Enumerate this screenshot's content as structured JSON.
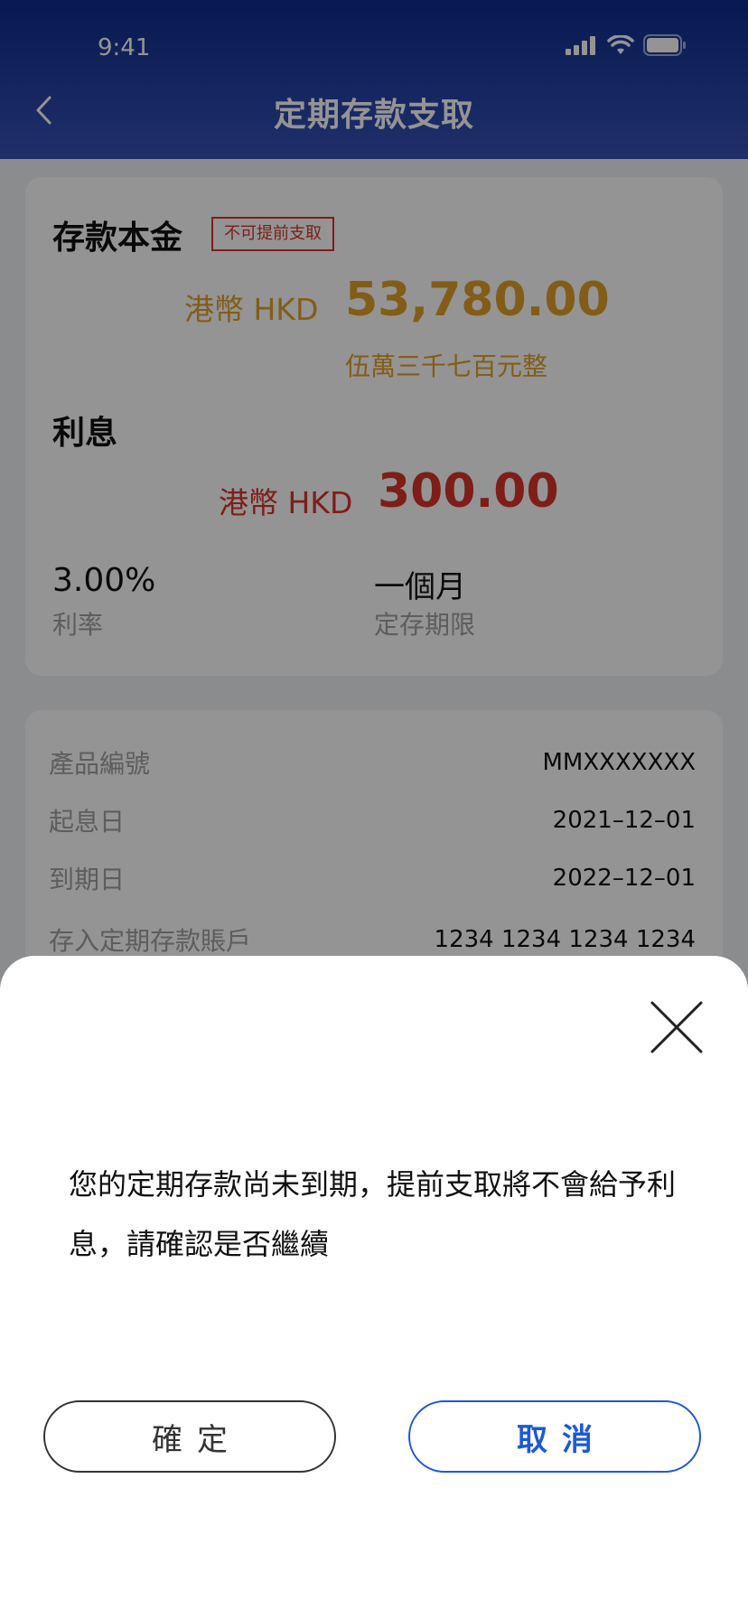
{
  "status_bar": {
    "time": "9:41"
  },
  "header": {
    "title": "定期存款支取"
  },
  "summary": {
    "principal_label": "存款本金",
    "tag": "不可提前支取",
    "principal_currency": "港幣 HKD",
    "principal_amount": "53,780.00",
    "principal_words": "伍萬三千七百元整",
    "interest_label": "利息",
    "interest_currency": "港幣 HKD",
    "interest_amount": "300.00",
    "rate_value": "3.00%",
    "rate_label": "利率",
    "term_value": "一個月",
    "term_label": "定存期限"
  },
  "details": [
    {
      "label": "產品編號",
      "value": "MMXXXXXXX"
    },
    {
      "label": "起息日",
      "value": "2021–12–01"
    },
    {
      "label": "到期日",
      "value": "2022–12–01"
    },
    {
      "label": "存入定期存款賬戶",
      "value": "1234 1234 1234 1234"
    }
  ],
  "dialog": {
    "message": "您的定期存款尚未到期，提前支取將不會給予利息，請確認是否繼續",
    "confirm_label": "確定",
    "cancel_label": "取消"
  },
  "colors": {
    "header_gradient_top": "#0e2c8c",
    "header_gradient_bottom": "#3852b8",
    "principal_gold": "#e0a028",
    "interest_red": "#d8342c",
    "cancel_blue": "#1d58d8"
  },
  "icons": [
    "back-arrow-icon",
    "signal-icon",
    "wifi-icon",
    "battery-icon",
    "close-icon"
  ]
}
